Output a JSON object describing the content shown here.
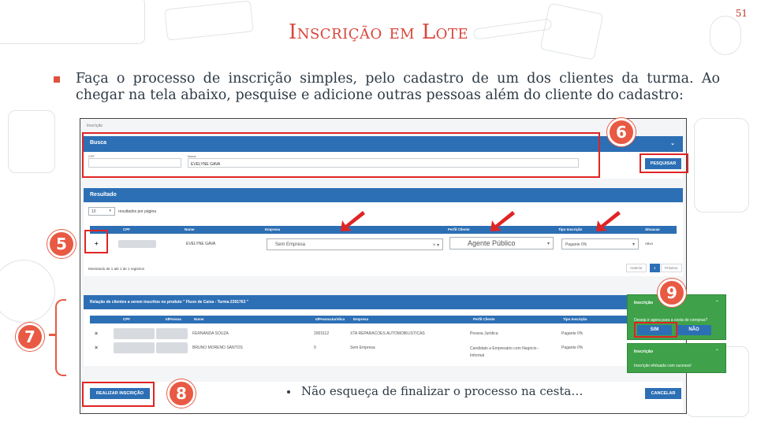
{
  "page_number": "51",
  "title": "Inscrição em Lote",
  "instruction": "Faça o processo de inscrição simples, pelo cadastro de um dos clientes da turma. Ao chegar na tela abaixo, pesquise e adicione outras pessoas além do cliente do cadastro:",
  "screenshot": {
    "breadcrumb": "Inscrição",
    "busca": {
      "header": "Busca",
      "cpf_label": "CPF",
      "nome_label": "Nome",
      "nome_value": "EVELYNE GAVA",
      "search_button": "PESQUISAR"
    },
    "resultado": {
      "header": "Resultado",
      "page_size": "10",
      "page_size_suffix": "resultados por página",
      "columns": [
        "CPF",
        "Nome",
        "Empresa",
        "Perfil Cliente",
        "Tipo Inscrição",
        "Situacao"
      ],
      "row": {
        "add_symbol": "+",
        "nome": "EVELYNE GAVA",
        "empresa": "Sem Empresa",
        "perfil": "Agente Público",
        "tipo": "Pagante 0%",
        "situacao": "Ativo"
      },
      "showing": "Mostrando de 1 até 1 de 1 registros",
      "pager": {
        "prev": "Anterior",
        "current": "1",
        "next": "Próximo"
      }
    },
    "relacao": {
      "header": "Relação de clientes a serem inscritos no produto \" Fluxo de Caixa - Turma 2391763 \"",
      "columns": [
        "CPF",
        "IdPessoa",
        "Nome",
        "IdPessoaJuridica",
        "Empresa",
        "Perfil Cliente",
        "Tipo Inscrição"
      ],
      "rows": [
        {
          "remove": "×",
          "nome": "FERNANDA SOUZA",
          "id_pj": "2003112",
          "empresa": "XTA REPARACOES AUTOMOBILISTICAS",
          "perfil": "Pessoa Jurídica",
          "tipo": "Pagante 0%"
        },
        {
          "remove": "×",
          "nome": "BRUNO MORENO SANTOS",
          "id_pj": "0",
          "empresa": "Sem Empresa",
          "perfil": "Candidato a Empresário com Negócio - Informal",
          "tipo": "Pagante 0%"
        }
      ]
    },
    "realizar_button": "REALIZAR INSCRIÇÃO",
    "cancelar_button": "CANCELAR",
    "popup_confirm": {
      "title": "Inscrição",
      "message": "Deseja ir agora para a cesta de compras?",
      "yes": "SIM",
      "no": "NÃO"
    },
    "popup_success": {
      "title": "Inscrição",
      "message": "Inscrição efetuada com sucesso!"
    }
  },
  "callouts": [
    "5",
    "6",
    "7",
    "8",
    "9"
  ],
  "note": "Não esqueça de finalizar o processo na cesta…",
  "colors": {
    "accent": "#d9453a",
    "badge": "#e85a43",
    "panel_blue": "#2d6fb5",
    "popup_green": "#3fa24a",
    "highlight_red": "#e02424"
  }
}
